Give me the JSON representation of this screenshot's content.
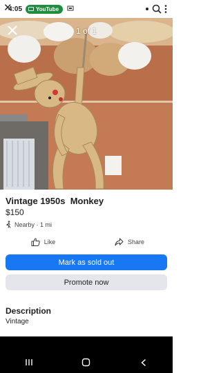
{
  "status_bar": {
    "time": "4:05",
    "youtube_label": "YouTube"
  },
  "photo": {
    "counter": "1 of 1"
  },
  "listing": {
    "title": "Vintage 1950s  Monkey",
    "price": "$150",
    "location": "Nearby · 1 mi"
  },
  "actions": {
    "like_label": "Like",
    "share_label": "Share"
  },
  "buttons": {
    "mark_sold": "Mark as sold out",
    "promote": "Promote now"
  },
  "description": {
    "heading": "Description",
    "text": "Vintage"
  },
  "colors": {
    "primary": "#1877f2",
    "secondary": "#e4e6eb",
    "youtube_badge": "#1e8e3e"
  },
  "icons": {
    "close": "close-icon",
    "like": "thumbs-up-icon",
    "share": "share-icon",
    "walk": "walking-person-icon"
  }
}
